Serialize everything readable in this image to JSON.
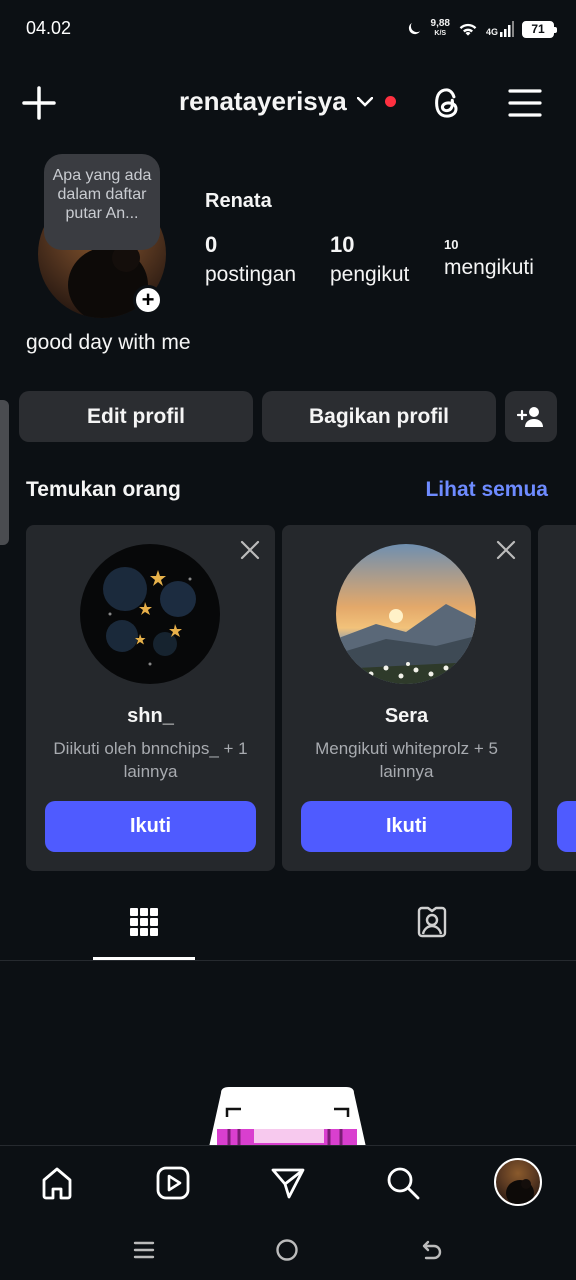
{
  "status_bar": {
    "time": "04.02",
    "net_speed_value": "9,88",
    "net_speed_unit": "K/S",
    "network": "4G",
    "battery": "71"
  },
  "header": {
    "username": "renatayerisya"
  },
  "profile": {
    "note_text": "Apa yang ada dalam daftar putar An...",
    "display_name": "Renata",
    "stats": {
      "posts_count": "0",
      "posts_label": "postingan",
      "followers_count": "10",
      "followers_label": "pengikut",
      "following_count": "10",
      "following_label": "mengikuti"
    },
    "bio": "good day with me"
  },
  "actions": {
    "edit_profile": "Edit profil",
    "share_profile": "Bagikan profil"
  },
  "discover": {
    "title": "Temukan orang",
    "see_all": "Lihat semua",
    "cards": [
      {
        "name": "shn_",
        "subtitle": "Diikuti oleh bnnchips_ + 1 lainnya",
        "button": "Ikuti"
      },
      {
        "name": "Sera",
        "subtitle": "Mengikuti whiteprolz + 5 lainnya",
        "button": "Ikuti"
      }
    ]
  },
  "tabs": [
    "grid-posts",
    "tagged"
  ],
  "bottom_nav": [
    "home-icon",
    "reels-icon",
    "direct-icon",
    "search-icon",
    "profile-avatar"
  ],
  "colors": {
    "background": "#0c1014",
    "button_bg": "#2b2d31",
    "accent_blue": "#4f5bff",
    "link_blue": "#6e8bff",
    "notification_red": "#ff3040"
  }
}
